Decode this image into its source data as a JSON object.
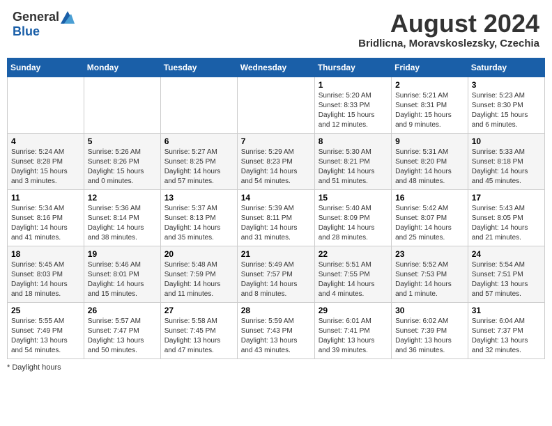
{
  "logo": {
    "general": "General",
    "blue": "Blue"
  },
  "title": {
    "month_year": "August 2024",
    "location": "Bridlicna, Moravskoslezsky, Czechia"
  },
  "days_of_week": [
    "Sunday",
    "Monday",
    "Tuesday",
    "Wednesday",
    "Thursday",
    "Friday",
    "Saturday"
  ],
  "footer": {
    "note": "Daylight hours"
  },
  "weeks": [
    {
      "days": [
        {
          "number": "",
          "info": ""
        },
        {
          "number": "",
          "info": ""
        },
        {
          "number": "",
          "info": ""
        },
        {
          "number": "",
          "info": ""
        },
        {
          "number": "1",
          "info": "Sunrise: 5:20 AM\nSunset: 8:33 PM\nDaylight: 15 hours\nand 12 minutes."
        },
        {
          "number": "2",
          "info": "Sunrise: 5:21 AM\nSunset: 8:31 PM\nDaylight: 15 hours\nand 9 minutes."
        },
        {
          "number": "3",
          "info": "Sunrise: 5:23 AM\nSunset: 8:30 PM\nDaylight: 15 hours\nand 6 minutes."
        }
      ]
    },
    {
      "days": [
        {
          "number": "4",
          "info": "Sunrise: 5:24 AM\nSunset: 8:28 PM\nDaylight: 15 hours\nand 3 minutes."
        },
        {
          "number": "5",
          "info": "Sunrise: 5:26 AM\nSunset: 8:26 PM\nDaylight: 15 hours\nand 0 minutes."
        },
        {
          "number": "6",
          "info": "Sunrise: 5:27 AM\nSunset: 8:25 PM\nDaylight: 14 hours\nand 57 minutes."
        },
        {
          "number": "7",
          "info": "Sunrise: 5:29 AM\nSunset: 8:23 PM\nDaylight: 14 hours\nand 54 minutes."
        },
        {
          "number": "8",
          "info": "Sunrise: 5:30 AM\nSunset: 8:21 PM\nDaylight: 14 hours\nand 51 minutes."
        },
        {
          "number": "9",
          "info": "Sunrise: 5:31 AM\nSunset: 8:20 PM\nDaylight: 14 hours\nand 48 minutes."
        },
        {
          "number": "10",
          "info": "Sunrise: 5:33 AM\nSunset: 8:18 PM\nDaylight: 14 hours\nand 45 minutes."
        }
      ]
    },
    {
      "days": [
        {
          "number": "11",
          "info": "Sunrise: 5:34 AM\nSunset: 8:16 PM\nDaylight: 14 hours\nand 41 minutes."
        },
        {
          "number": "12",
          "info": "Sunrise: 5:36 AM\nSunset: 8:14 PM\nDaylight: 14 hours\nand 38 minutes."
        },
        {
          "number": "13",
          "info": "Sunrise: 5:37 AM\nSunset: 8:13 PM\nDaylight: 14 hours\nand 35 minutes."
        },
        {
          "number": "14",
          "info": "Sunrise: 5:39 AM\nSunset: 8:11 PM\nDaylight: 14 hours\nand 31 minutes."
        },
        {
          "number": "15",
          "info": "Sunrise: 5:40 AM\nSunset: 8:09 PM\nDaylight: 14 hours\nand 28 minutes."
        },
        {
          "number": "16",
          "info": "Sunrise: 5:42 AM\nSunset: 8:07 PM\nDaylight: 14 hours\nand 25 minutes."
        },
        {
          "number": "17",
          "info": "Sunrise: 5:43 AM\nSunset: 8:05 PM\nDaylight: 14 hours\nand 21 minutes."
        }
      ]
    },
    {
      "days": [
        {
          "number": "18",
          "info": "Sunrise: 5:45 AM\nSunset: 8:03 PM\nDaylight: 14 hours\nand 18 minutes."
        },
        {
          "number": "19",
          "info": "Sunrise: 5:46 AM\nSunset: 8:01 PM\nDaylight: 14 hours\nand 15 minutes."
        },
        {
          "number": "20",
          "info": "Sunrise: 5:48 AM\nSunset: 7:59 PM\nDaylight: 14 hours\nand 11 minutes."
        },
        {
          "number": "21",
          "info": "Sunrise: 5:49 AM\nSunset: 7:57 PM\nDaylight: 14 hours\nand 8 minutes."
        },
        {
          "number": "22",
          "info": "Sunrise: 5:51 AM\nSunset: 7:55 PM\nDaylight: 14 hours\nand 4 minutes."
        },
        {
          "number": "23",
          "info": "Sunrise: 5:52 AM\nSunset: 7:53 PM\nDaylight: 14 hours\nand 1 minute."
        },
        {
          "number": "24",
          "info": "Sunrise: 5:54 AM\nSunset: 7:51 PM\nDaylight: 13 hours\nand 57 minutes."
        }
      ]
    },
    {
      "days": [
        {
          "number": "25",
          "info": "Sunrise: 5:55 AM\nSunset: 7:49 PM\nDaylight: 13 hours\nand 54 minutes."
        },
        {
          "number": "26",
          "info": "Sunrise: 5:57 AM\nSunset: 7:47 PM\nDaylight: 13 hours\nand 50 minutes."
        },
        {
          "number": "27",
          "info": "Sunrise: 5:58 AM\nSunset: 7:45 PM\nDaylight: 13 hours\nand 47 minutes."
        },
        {
          "number": "28",
          "info": "Sunrise: 5:59 AM\nSunset: 7:43 PM\nDaylight: 13 hours\nand 43 minutes."
        },
        {
          "number": "29",
          "info": "Sunrise: 6:01 AM\nSunset: 7:41 PM\nDaylight: 13 hours\nand 39 minutes."
        },
        {
          "number": "30",
          "info": "Sunrise: 6:02 AM\nSunset: 7:39 PM\nDaylight: 13 hours\nand 36 minutes."
        },
        {
          "number": "31",
          "info": "Sunrise: 6:04 AM\nSunset: 7:37 PM\nDaylight: 13 hours\nand 32 minutes."
        }
      ]
    }
  ]
}
